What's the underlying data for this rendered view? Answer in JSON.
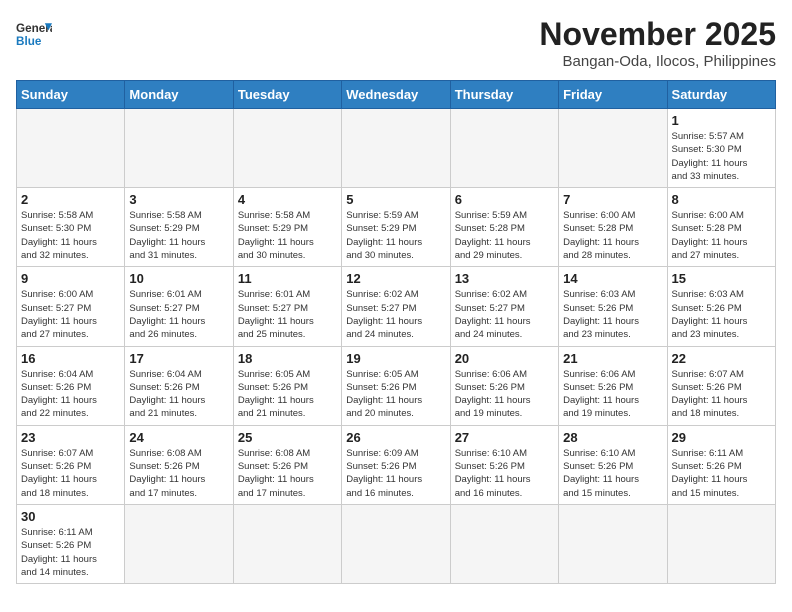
{
  "header": {
    "logo_general": "General",
    "logo_blue": "Blue",
    "month_title": "November 2025",
    "location": "Bangan-Oda, Ilocos, Philippines"
  },
  "days_of_week": [
    "Sunday",
    "Monday",
    "Tuesday",
    "Wednesday",
    "Thursday",
    "Friday",
    "Saturday"
  ],
  "weeks": [
    [
      {
        "day": "",
        "info": ""
      },
      {
        "day": "",
        "info": ""
      },
      {
        "day": "",
        "info": ""
      },
      {
        "day": "",
        "info": ""
      },
      {
        "day": "",
        "info": ""
      },
      {
        "day": "",
        "info": ""
      },
      {
        "day": "1",
        "info": "Sunrise: 5:57 AM\nSunset: 5:30 PM\nDaylight: 11 hours\nand 33 minutes."
      }
    ],
    [
      {
        "day": "2",
        "info": "Sunrise: 5:58 AM\nSunset: 5:30 PM\nDaylight: 11 hours\nand 32 minutes."
      },
      {
        "day": "3",
        "info": "Sunrise: 5:58 AM\nSunset: 5:29 PM\nDaylight: 11 hours\nand 31 minutes."
      },
      {
        "day": "4",
        "info": "Sunrise: 5:58 AM\nSunset: 5:29 PM\nDaylight: 11 hours\nand 30 minutes."
      },
      {
        "day": "5",
        "info": "Sunrise: 5:59 AM\nSunset: 5:29 PM\nDaylight: 11 hours\nand 30 minutes."
      },
      {
        "day": "6",
        "info": "Sunrise: 5:59 AM\nSunset: 5:28 PM\nDaylight: 11 hours\nand 29 minutes."
      },
      {
        "day": "7",
        "info": "Sunrise: 6:00 AM\nSunset: 5:28 PM\nDaylight: 11 hours\nand 28 minutes."
      },
      {
        "day": "8",
        "info": "Sunrise: 6:00 AM\nSunset: 5:28 PM\nDaylight: 11 hours\nand 27 minutes."
      }
    ],
    [
      {
        "day": "9",
        "info": "Sunrise: 6:00 AM\nSunset: 5:27 PM\nDaylight: 11 hours\nand 27 minutes."
      },
      {
        "day": "10",
        "info": "Sunrise: 6:01 AM\nSunset: 5:27 PM\nDaylight: 11 hours\nand 26 minutes."
      },
      {
        "day": "11",
        "info": "Sunrise: 6:01 AM\nSunset: 5:27 PM\nDaylight: 11 hours\nand 25 minutes."
      },
      {
        "day": "12",
        "info": "Sunrise: 6:02 AM\nSunset: 5:27 PM\nDaylight: 11 hours\nand 24 minutes."
      },
      {
        "day": "13",
        "info": "Sunrise: 6:02 AM\nSunset: 5:27 PM\nDaylight: 11 hours\nand 24 minutes."
      },
      {
        "day": "14",
        "info": "Sunrise: 6:03 AM\nSunset: 5:26 PM\nDaylight: 11 hours\nand 23 minutes."
      },
      {
        "day": "15",
        "info": "Sunrise: 6:03 AM\nSunset: 5:26 PM\nDaylight: 11 hours\nand 23 minutes."
      }
    ],
    [
      {
        "day": "16",
        "info": "Sunrise: 6:04 AM\nSunset: 5:26 PM\nDaylight: 11 hours\nand 22 minutes."
      },
      {
        "day": "17",
        "info": "Sunrise: 6:04 AM\nSunset: 5:26 PM\nDaylight: 11 hours\nand 21 minutes."
      },
      {
        "day": "18",
        "info": "Sunrise: 6:05 AM\nSunset: 5:26 PM\nDaylight: 11 hours\nand 21 minutes."
      },
      {
        "day": "19",
        "info": "Sunrise: 6:05 AM\nSunset: 5:26 PM\nDaylight: 11 hours\nand 20 minutes."
      },
      {
        "day": "20",
        "info": "Sunrise: 6:06 AM\nSunset: 5:26 PM\nDaylight: 11 hours\nand 19 minutes."
      },
      {
        "day": "21",
        "info": "Sunrise: 6:06 AM\nSunset: 5:26 PM\nDaylight: 11 hours\nand 19 minutes."
      },
      {
        "day": "22",
        "info": "Sunrise: 6:07 AM\nSunset: 5:26 PM\nDaylight: 11 hours\nand 18 minutes."
      }
    ],
    [
      {
        "day": "23",
        "info": "Sunrise: 6:07 AM\nSunset: 5:26 PM\nDaylight: 11 hours\nand 18 minutes."
      },
      {
        "day": "24",
        "info": "Sunrise: 6:08 AM\nSunset: 5:26 PM\nDaylight: 11 hours\nand 17 minutes."
      },
      {
        "day": "25",
        "info": "Sunrise: 6:08 AM\nSunset: 5:26 PM\nDaylight: 11 hours\nand 17 minutes."
      },
      {
        "day": "26",
        "info": "Sunrise: 6:09 AM\nSunset: 5:26 PM\nDaylight: 11 hours\nand 16 minutes."
      },
      {
        "day": "27",
        "info": "Sunrise: 6:10 AM\nSunset: 5:26 PM\nDaylight: 11 hours\nand 16 minutes."
      },
      {
        "day": "28",
        "info": "Sunrise: 6:10 AM\nSunset: 5:26 PM\nDaylight: 11 hours\nand 15 minutes."
      },
      {
        "day": "29",
        "info": "Sunrise: 6:11 AM\nSunset: 5:26 PM\nDaylight: 11 hours\nand 15 minutes."
      }
    ],
    [
      {
        "day": "30",
        "info": "Sunrise: 6:11 AM\nSunset: 5:26 PM\nDaylight: 11 hours\nand 14 minutes."
      },
      {
        "day": "",
        "info": ""
      },
      {
        "day": "",
        "info": ""
      },
      {
        "day": "",
        "info": ""
      },
      {
        "day": "",
        "info": ""
      },
      {
        "day": "",
        "info": ""
      },
      {
        "day": "",
        "info": ""
      }
    ]
  ]
}
